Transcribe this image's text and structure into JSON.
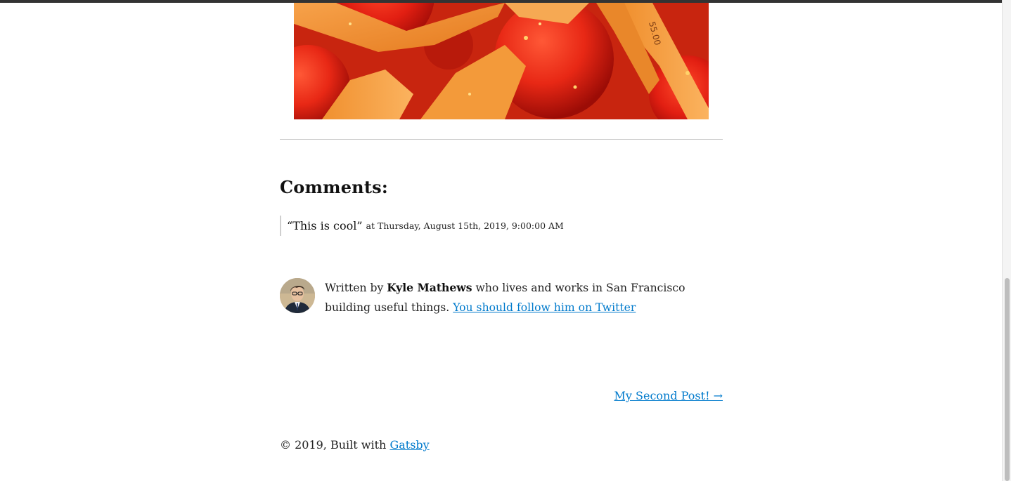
{
  "hero_image": {
    "description_icon": "photo-image",
    "printed_labels": [
      "55.00"
    ]
  },
  "comments": {
    "heading": "Comments:",
    "items": [
      {
        "text": "“This is cool”",
        "at_label": "at",
        "date": "Thursday, August 15th, 2019, 9:00:00 AM"
      }
    ]
  },
  "bio": {
    "prefix": "Written by",
    "author": "Kyle Mathews",
    "suffix": "who lives and works in San Francisco building useful things.",
    "follow_link": "You should follow him on Twitter",
    "avatar_icon": "avatar-photo"
  },
  "navigation": {
    "next_label": "My Second Post! →"
  },
  "footer": {
    "copyright": "© 2019, Built with",
    "gatsby_link": "Gatsby"
  },
  "colors": {
    "link": "#007acc",
    "text": "#222222",
    "topbar": "#333333",
    "rule": "#cccccc"
  }
}
